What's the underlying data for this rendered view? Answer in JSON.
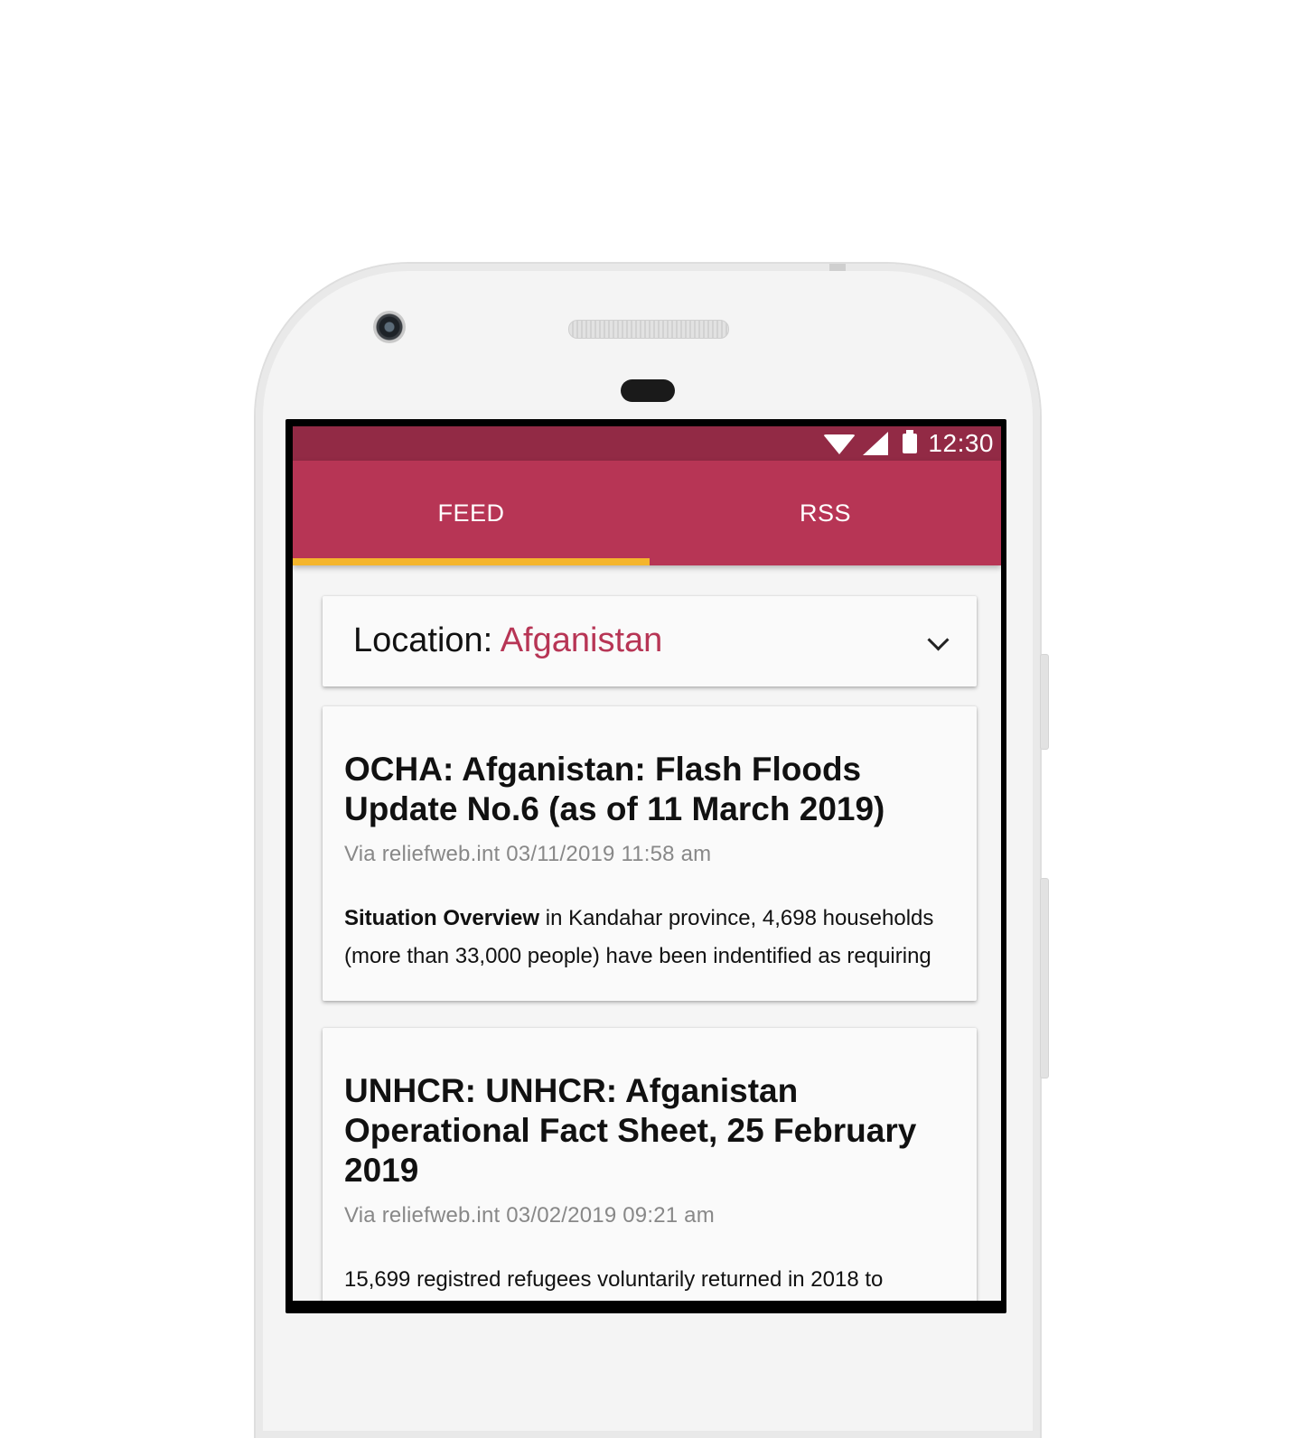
{
  "status_bar": {
    "time": "12:30",
    "icons": [
      "wifi-icon",
      "signal-icon",
      "battery-icon"
    ],
    "color": "#922a45"
  },
  "tabs": {
    "items": [
      {
        "label": "FEED",
        "selected": true
      },
      {
        "label": "RSS",
        "selected": false
      }
    ],
    "color": "#b73555",
    "indicator_color": "#f4b52c"
  },
  "location": {
    "label": "Location:",
    "value": "Afganistan",
    "icon": "chevron-down-icon"
  },
  "feed": {
    "items": [
      {
        "title": "OCHA: Afganistan: Flash Floods Update No.6 (as of 11 March 2019)",
        "meta": "Via reliefweb.int 03/11/2019 11:58 am",
        "body_bold": "Situation Overview",
        "body": " in Kandahar province, 4,698 households (more than 33,000 people) have been indentified as requiring"
      },
      {
        "title": "UNHCR: UNHCR: Afganistan Operational Fact Sheet, 25 February 2019",
        "meta": "Via reliefweb.int 03/02/2019 09:21 am",
        "body_bold": "",
        "body": "15,699 registred refugees voluntarily returned in 2018 to"
      }
    ]
  }
}
